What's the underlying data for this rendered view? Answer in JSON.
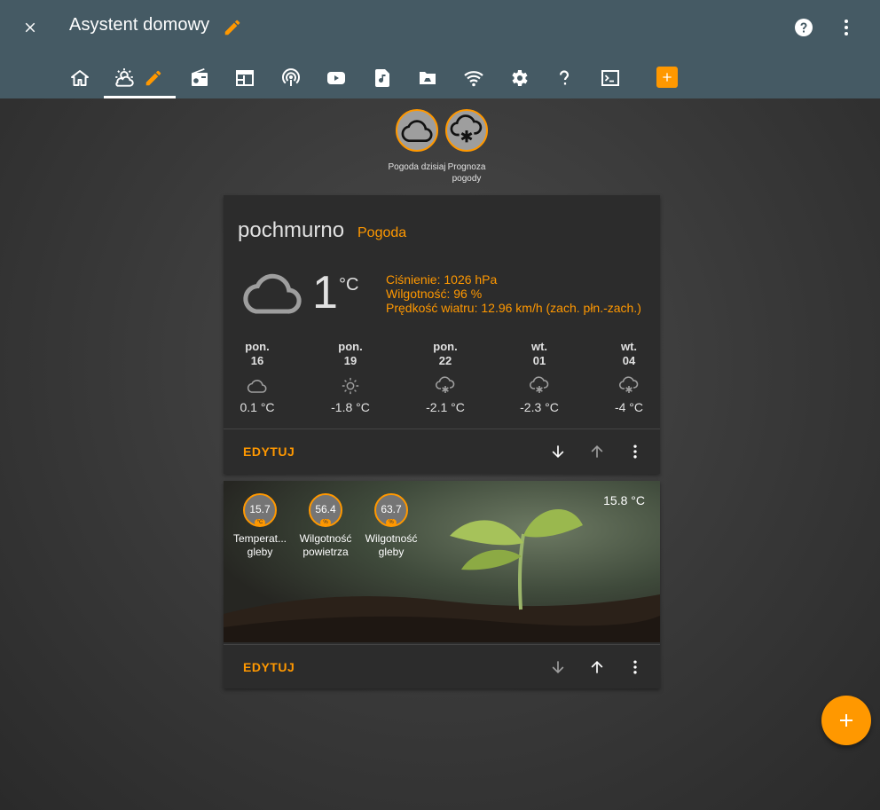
{
  "header": {
    "title": "Asystent domowy",
    "tabs": [
      {
        "name": "home-icon"
      },
      {
        "name": "weather-partly-cloudy-icon",
        "active": true
      },
      {
        "name": "radio-icon"
      },
      {
        "name": "calendar-icon"
      },
      {
        "name": "podcast-icon"
      },
      {
        "name": "youtube-icon"
      },
      {
        "name": "music-file-icon"
      },
      {
        "name": "cloud-folder-icon"
      },
      {
        "name": "wifi-icon"
      },
      {
        "name": "settings-icon"
      },
      {
        "name": "help-icon"
      },
      {
        "name": "console-icon"
      }
    ]
  },
  "badges": [
    {
      "label": "Pogoda dzisiaj",
      "icon": "cloud-icon"
    },
    {
      "label": "Prognoza pogody",
      "icon": "snowflake-cloud-icon"
    }
  ],
  "weather": {
    "condition": "pochmurno",
    "name": "Pogoda",
    "temperature": "1",
    "unit": "°C",
    "pressure": "Ciśnienie: 1026 hPa",
    "humidity": "Wilgotność: 96 %",
    "wind": "Prędkość wiatru: 12.96 km/h (zach. płn.-zach.)",
    "forecast": [
      {
        "day": "pon.",
        "date": "16",
        "icon": "cloud-icon",
        "temp": "0.1 °C"
      },
      {
        "day": "pon.",
        "date": "19",
        "icon": "sun-icon",
        "temp": "-1.8 °C"
      },
      {
        "day": "pon.",
        "date": "22",
        "icon": "snowy-icon",
        "temp": "-2.1 °C"
      },
      {
        "day": "wt.",
        "date": "01",
        "icon": "snowy-icon",
        "temp": "-2.3 °C"
      },
      {
        "day": "wt.",
        "date": "04",
        "icon": "snowy-icon",
        "temp": "-4 °C"
      }
    ],
    "edit_label": "EDYTUJ"
  },
  "plant": {
    "sensors": [
      {
        "value": "15.7",
        "unit": "°C",
        "label": "Temperat... gleby"
      },
      {
        "value": "56.4",
        "unit": "%",
        "label": "Wilgotność powietrza"
      },
      {
        "value": "63.7",
        "unit": "%",
        "label": "Wilgotność gleby"
      }
    ],
    "temperature": "15.8 °C",
    "edit_label": "EDYTUJ"
  },
  "colors": {
    "accent": "#ff9800",
    "header": "#455a64",
    "card": "#2c2c2c"
  }
}
